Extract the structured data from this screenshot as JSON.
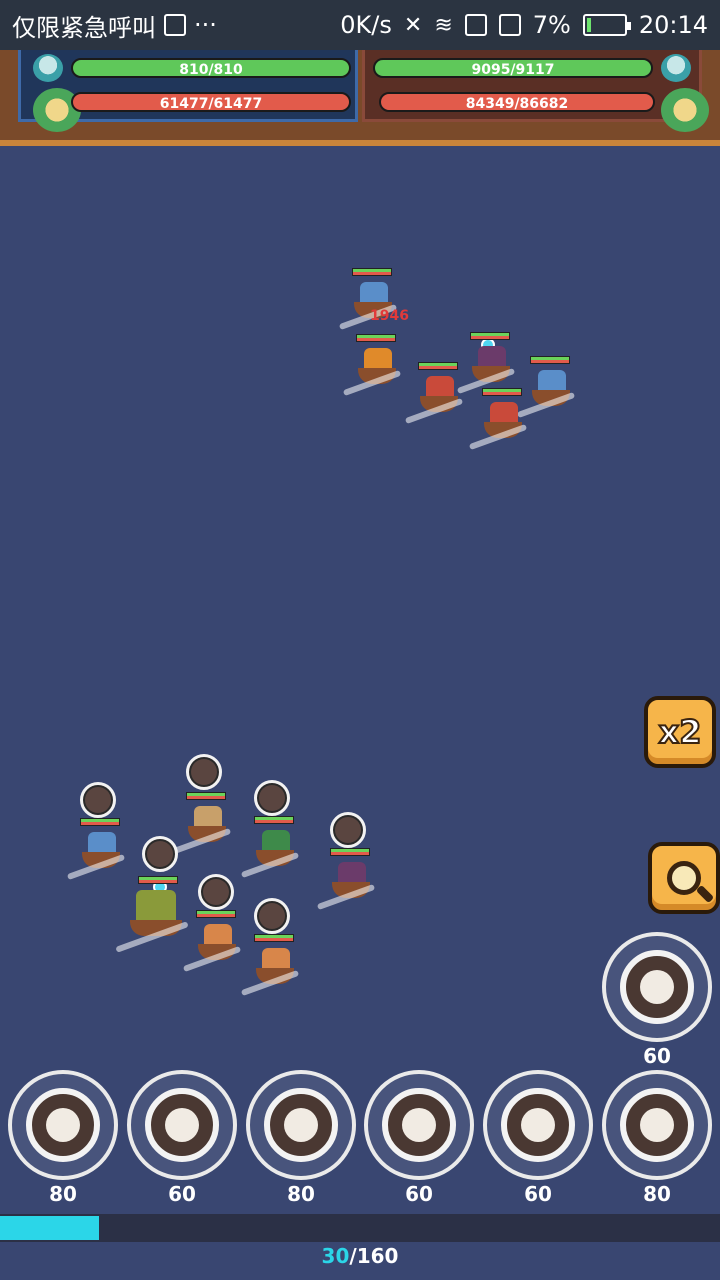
{
  "status_bar": {
    "carrier": "仅限紧急呼叫",
    "dots": "···",
    "speed": "0K/s",
    "battery": "7%",
    "time": "20:14"
  },
  "hud": {
    "player_crew": "810/810",
    "player_ships": "61477/61477",
    "enemy_crew": "9095/9117",
    "enemy_ships": "84349/86682"
  },
  "battle": {
    "damage_text": "1946"
  },
  "buttons": {
    "speed_label": "x2"
  },
  "special_skill": {
    "cost": "60"
  },
  "skills": [
    {
      "cost": "80"
    },
    {
      "cost": "60"
    },
    {
      "cost": "80"
    },
    {
      "cost": "60"
    },
    {
      "cost": "60"
    },
    {
      "cost": "80"
    }
  ],
  "energy": {
    "current": "30",
    "max": "/160",
    "fraction": 0.1875
  }
}
